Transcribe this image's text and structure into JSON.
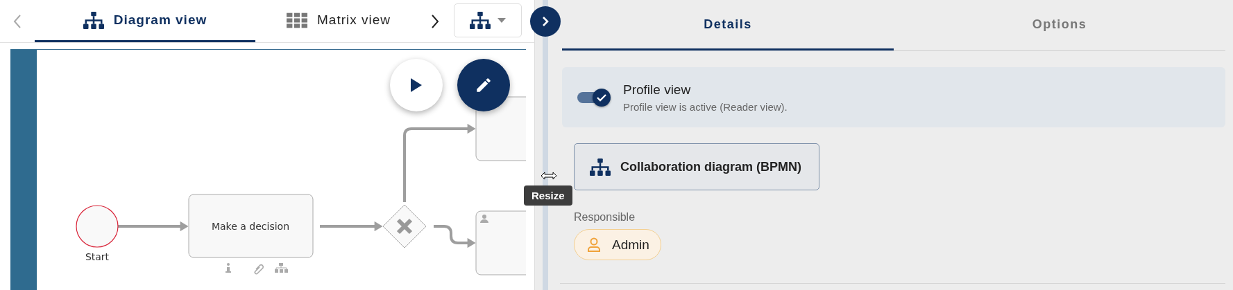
{
  "view_tabs": [
    {
      "label": "Diagram view",
      "selected": true
    },
    {
      "label": "Matrix view",
      "selected": false
    }
  ],
  "diagram": {
    "nodes": [
      {
        "kind": "start",
        "label": "Start"
      },
      {
        "kind": "task",
        "label": "Make a decision"
      },
      {
        "kind": "gateway"
      },
      {
        "kind": "task_partial"
      },
      {
        "kind": "user_task_partial"
      }
    ]
  },
  "tooltip": "Resize",
  "detail_tabs": [
    {
      "label": "Details",
      "selected": true
    },
    {
      "label": "Options",
      "selected": false
    }
  ],
  "profile_view": {
    "label": "Profile view",
    "description": "Profile view is active (Reader view).",
    "on": true
  },
  "diagram_type_button": "Collaboration diagram (BPMN)",
  "responsible": {
    "label": "Responsible",
    "person": "Admin"
  }
}
